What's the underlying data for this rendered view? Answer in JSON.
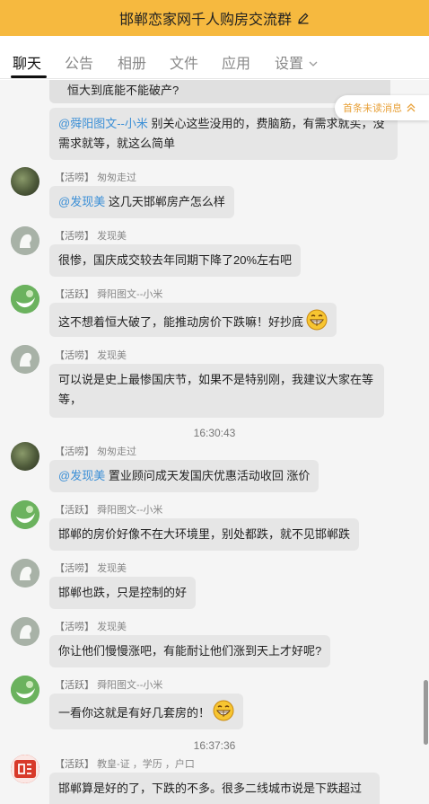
{
  "header": {
    "title": "邯郸恋家网千人购房交流群",
    "accent": "#f6b93f"
  },
  "tabs": [
    {
      "label": "聊天"
    },
    {
      "label": "公告"
    },
    {
      "label": "相册"
    },
    {
      "label": "文件"
    },
    {
      "label": "应用"
    },
    {
      "label": "设置"
    }
  ],
  "unread_label": "首条未读消息",
  "messages": [
    {
      "line1": "恒大到底能不能破产?"
    },
    {
      "mention": "@舜阳图文--小米",
      "line1": " 别关心这些没用的，费脑筋，有需求就买，没",
      "line2": "需求就等，就这么简单"
    },
    {
      "tag": "【活唠】",
      "name": "匆匆走过",
      "mention": "@发现美",
      "text": " 这几天邯郸房产怎么样"
    },
    {
      "tag": "【活唠】",
      "name": "发现美",
      "text": "很惨，国庆成交较去年同期下降了20%左右吧"
    },
    {
      "tag": "【活跃】",
      "name": "舜阳图文--小米",
      "text": "这不想着恒大破了，能推动房价下跌嘛！好抄底"
    },
    {
      "tag": "【活唠】",
      "name": "发现美",
      "line1": "可以说是史上最惨国庆节，如果不是特别刚，我建议大家在等",
      "line2": "等，"
    },
    {
      "time": "16:30:43"
    },
    {
      "tag": "【活唠】",
      "name": "匆匆走过",
      "mention": "@发现美",
      "text": " 置业顾问成天发国庆优惠活动收回  涨价"
    },
    {
      "tag": "【活跃】",
      "name": "舜阳图文--小米",
      "text": "邯郸的房价好像不在大环境里，别处都跌，就不见邯郸跌"
    },
    {
      "tag": "【活唠】",
      "name": "发现美",
      "text": "邯郸也跌，只是控制的好"
    },
    {
      "tag": "【活唠】",
      "name": "发现美",
      "text": "你让他们慢慢涨吧，有能耐让他们涨到天上才好呢?"
    },
    {
      "tag": "【活跃】",
      "name": "舜阳图文--小米",
      "text": "一看你这就是有好几套房的！"
    },
    {
      "time": "16:37:36"
    },
    {
      "tag": "【活跃】",
      "name": "教皇-证 ，学历 ，户口",
      "text": "邯郸算是好的了，下跌的不多。很多二线城市说是下跌超过"
    }
  ]
}
